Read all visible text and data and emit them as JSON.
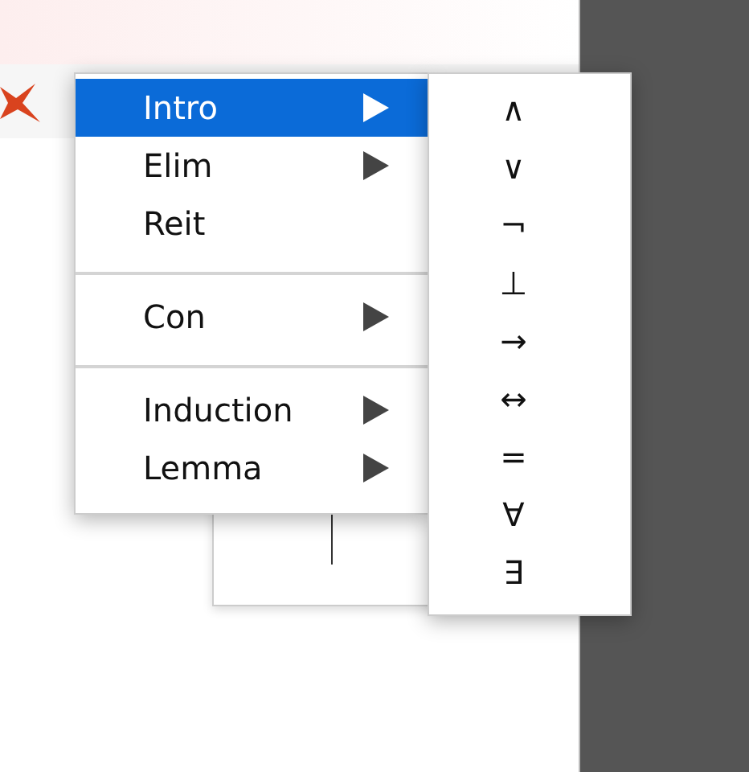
{
  "menu": {
    "items": [
      {
        "kind": "item",
        "label": "Intro",
        "selected": true,
        "submenu": true
      },
      {
        "kind": "item",
        "label": "Elim",
        "selected": false,
        "submenu": true
      },
      {
        "kind": "item",
        "label": "Reit",
        "selected": false,
        "submenu": false
      },
      {
        "kind": "separator"
      },
      {
        "kind": "item",
        "label": "Con",
        "selected": false,
        "submenu": true
      },
      {
        "kind": "separator"
      },
      {
        "kind": "item",
        "label": "Induction",
        "selected": false,
        "submenu": true
      },
      {
        "kind": "item",
        "label": "Lemma",
        "selected": false,
        "submenu": true
      }
    ]
  },
  "submenu": {
    "items": [
      {
        "label": "∧"
      },
      {
        "label": "∨"
      },
      {
        "label": "¬"
      },
      {
        "label": "⊥"
      },
      {
        "label": "→"
      },
      {
        "label": "↔"
      },
      {
        "label": "="
      },
      {
        "label": "∀"
      },
      {
        "label": "∃"
      }
    ]
  }
}
